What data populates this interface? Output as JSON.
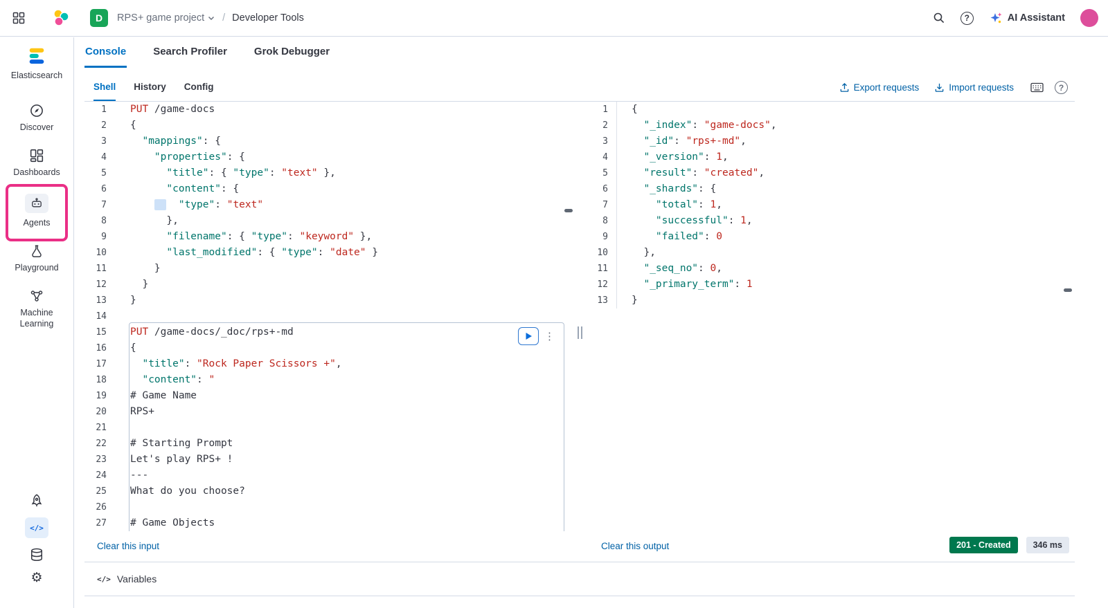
{
  "colors": {
    "accent_blue": "#0071c2",
    "link_blue": "#0061a6",
    "annotation_pink": "#ea2f86",
    "status_green": "#00784e",
    "token_key": "#00756b",
    "token_red": "#bd271e",
    "badge_green_bg": "#18a558"
  },
  "topbar": {
    "project_badge": "D",
    "project_name": "RPS+ game project",
    "page_name": "Developer Tools",
    "ai_assistant_label": "AI Assistant"
  },
  "sidebar": {
    "brand": "Elasticsearch",
    "items": [
      {
        "label": "Discover"
      },
      {
        "label": "Dashboards"
      },
      {
        "label": "Agents"
      },
      {
        "label": "Playground"
      },
      {
        "label": "Machine Learning"
      }
    ]
  },
  "tabs": [
    {
      "label": "Console"
    },
    {
      "label": "Search Profiler"
    },
    {
      "label": "Grok Debugger"
    }
  ],
  "icons": {
    "help_glyph": "?",
    "gear_glyph": "⚙",
    "kebab_glyph": "⋮",
    "code_glyph": "</>",
    "variables_glyph": "</>"
  },
  "console": {
    "subtabs": [
      {
        "label": "Shell"
      },
      {
        "label": "History"
      },
      {
        "label": "Config"
      }
    ],
    "export_label": "Export requests",
    "import_label": "Import requests",
    "input": {
      "clear_label": "Clear this input",
      "lines": [
        [
          [
            "m",
            "PUT "
          ],
          [
            "p",
            "/game-docs"
          ]
        ],
        [
          [
            "t",
            "{"
          ]
        ],
        [
          [
            "t",
            "  "
          ],
          [
            "k",
            "\"mappings\""
          ],
          [
            "t",
            ": {"
          ]
        ],
        [
          [
            "t",
            "    "
          ],
          [
            "k",
            "\"properties\""
          ],
          [
            "t",
            ": {"
          ]
        ],
        [
          [
            "t",
            "      "
          ],
          [
            "k",
            "\"title\""
          ],
          [
            "t",
            ": { "
          ],
          [
            "k",
            "\"type\""
          ],
          [
            "t",
            ": "
          ],
          [
            "s",
            "\"text\""
          ],
          [
            "t",
            " },"
          ]
        ],
        [
          [
            "t",
            "      "
          ],
          [
            "k",
            "\"content\""
          ],
          [
            "t",
            ": {"
          ]
        ],
        [
          [
            "t",
            "    "
          ],
          [
            "hl",
            "  "
          ],
          [
            "t",
            "  "
          ],
          [
            "k",
            "\"type\""
          ],
          [
            "t",
            ": "
          ],
          [
            "s",
            "\"text\""
          ]
        ],
        [
          [
            "t",
            "      },"
          ]
        ],
        [
          [
            "t",
            "      "
          ],
          [
            "k",
            "\"filename\""
          ],
          [
            "t",
            ": { "
          ],
          [
            "k",
            "\"type\""
          ],
          [
            "t",
            ": "
          ],
          [
            "s",
            "\"keyword\""
          ],
          [
            "t",
            " },"
          ]
        ],
        [
          [
            "t",
            "      "
          ],
          [
            "k",
            "\"last_modified\""
          ],
          [
            "t",
            ": { "
          ],
          [
            "k",
            "\"type\""
          ],
          [
            "t",
            ": "
          ],
          [
            "s",
            "\"date\""
          ],
          [
            "t",
            " }"
          ]
        ],
        [
          [
            "t",
            "    }"
          ]
        ],
        [
          [
            "t",
            "  }"
          ]
        ],
        [
          [
            "t",
            "}"
          ]
        ],
        [],
        [
          [
            "m",
            "PUT "
          ],
          [
            "p",
            "/game-docs/_doc/rps+-md"
          ]
        ],
        [
          [
            "t",
            "{"
          ]
        ],
        [
          [
            "t",
            "  "
          ],
          [
            "k",
            "\"title\""
          ],
          [
            "t",
            ": "
          ],
          [
            "s",
            "\"Rock Paper Scissors +\""
          ],
          [
            "t",
            ","
          ]
        ],
        [
          [
            "t",
            "  "
          ],
          [
            "k",
            "\"content\""
          ],
          [
            "t",
            ": "
          ],
          [
            "s",
            "\""
          ]
        ],
        [
          [
            "t",
            "# Game Name"
          ]
        ],
        [
          [
            "t",
            "RPS+"
          ]
        ],
        [],
        [
          [
            "t",
            "# Starting Prompt"
          ]
        ],
        [
          [
            "t",
            "Let's play RPS+ !"
          ]
        ],
        [
          [
            "t",
            "---"
          ]
        ],
        [
          [
            "t",
            "What do you choose?"
          ]
        ],
        [],
        [
          [
            "t",
            "# Game Objects"
          ]
        ]
      ]
    },
    "output": {
      "clear_label": "Clear this output",
      "status_badge": "201 - Created",
      "duration_badge": "346 ms",
      "lines": [
        [
          [
            "t",
            "{"
          ]
        ],
        [
          [
            "t",
            "  "
          ],
          [
            "k",
            "\"_index\""
          ],
          [
            "t",
            ": "
          ],
          [
            "s",
            "\"game-docs\""
          ],
          [
            "t",
            ","
          ]
        ],
        [
          [
            "t",
            "  "
          ],
          [
            "k",
            "\"_id\""
          ],
          [
            "t",
            ": "
          ],
          [
            "s",
            "\"rps+-md\""
          ],
          [
            "t",
            ","
          ]
        ],
        [
          [
            "t",
            "  "
          ],
          [
            "k",
            "\"_version\""
          ],
          [
            "t",
            ": "
          ],
          [
            "n",
            "1"
          ],
          [
            "t",
            ","
          ]
        ],
        [
          [
            "t",
            "  "
          ],
          [
            "k",
            "\"result\""
          ],
          [
            "t",
            ": "
          ],
          [
            "s",
            "\"created\""
          ],
          [
            "t",
            ","
          ]
        ],
        [
          [
            "t",
            "  "
          ],
          [
            "k",
            "\"_shards\""
          ],
          [
            "t",
            ": {"
          ]
        ],
        [
          [
            "t",
            "    "
          ],
          [
            "k",
            "\"total\""
          ],
          [
            "t",
            ": "
          ],
          [
            "n",
            "1"
          ],
          [
            "t",
            ","
          ]
        ],
        [
          [
            "t",
            "    "
          ],
          [
            "k",
            "\"successful\""
          ],
          [
            "t",
            ": "
          ],
          [
            "n",
            "1"
          ],
          [
            "t",
            ","
          ]
        ],
        [
          [
            "t",
            "    "
          ],
          [
            "k",
            "\"failed\""
          ],
          [
            "t",
            ": "
          ],
          [
            "n",
            "0"
          ]
        ],
        [
          [
            "t",
            "  },"
          ]
        ],
        [
          [
            "t",
            "  "
          ],
          [
            "k",
            "\"_seq_no\""
          ],
          [
            "t",
            ": "
          ],
          [
            "n",
            "0"
          ],
          [
            "t",
            ","
          ]
        ],
        [
          [
            "t",
            "  "
          ],
          [
            "k",
            "\"_primary_term\""
          ],
          [
            "t",
            ": "
          ],
          [
            "n",
            "1"
          ]
        ],
        [
          [
            "t",
            "}"
          ]
        ]
      ]
    },
    "variables_label": "Variables"
  }
}
